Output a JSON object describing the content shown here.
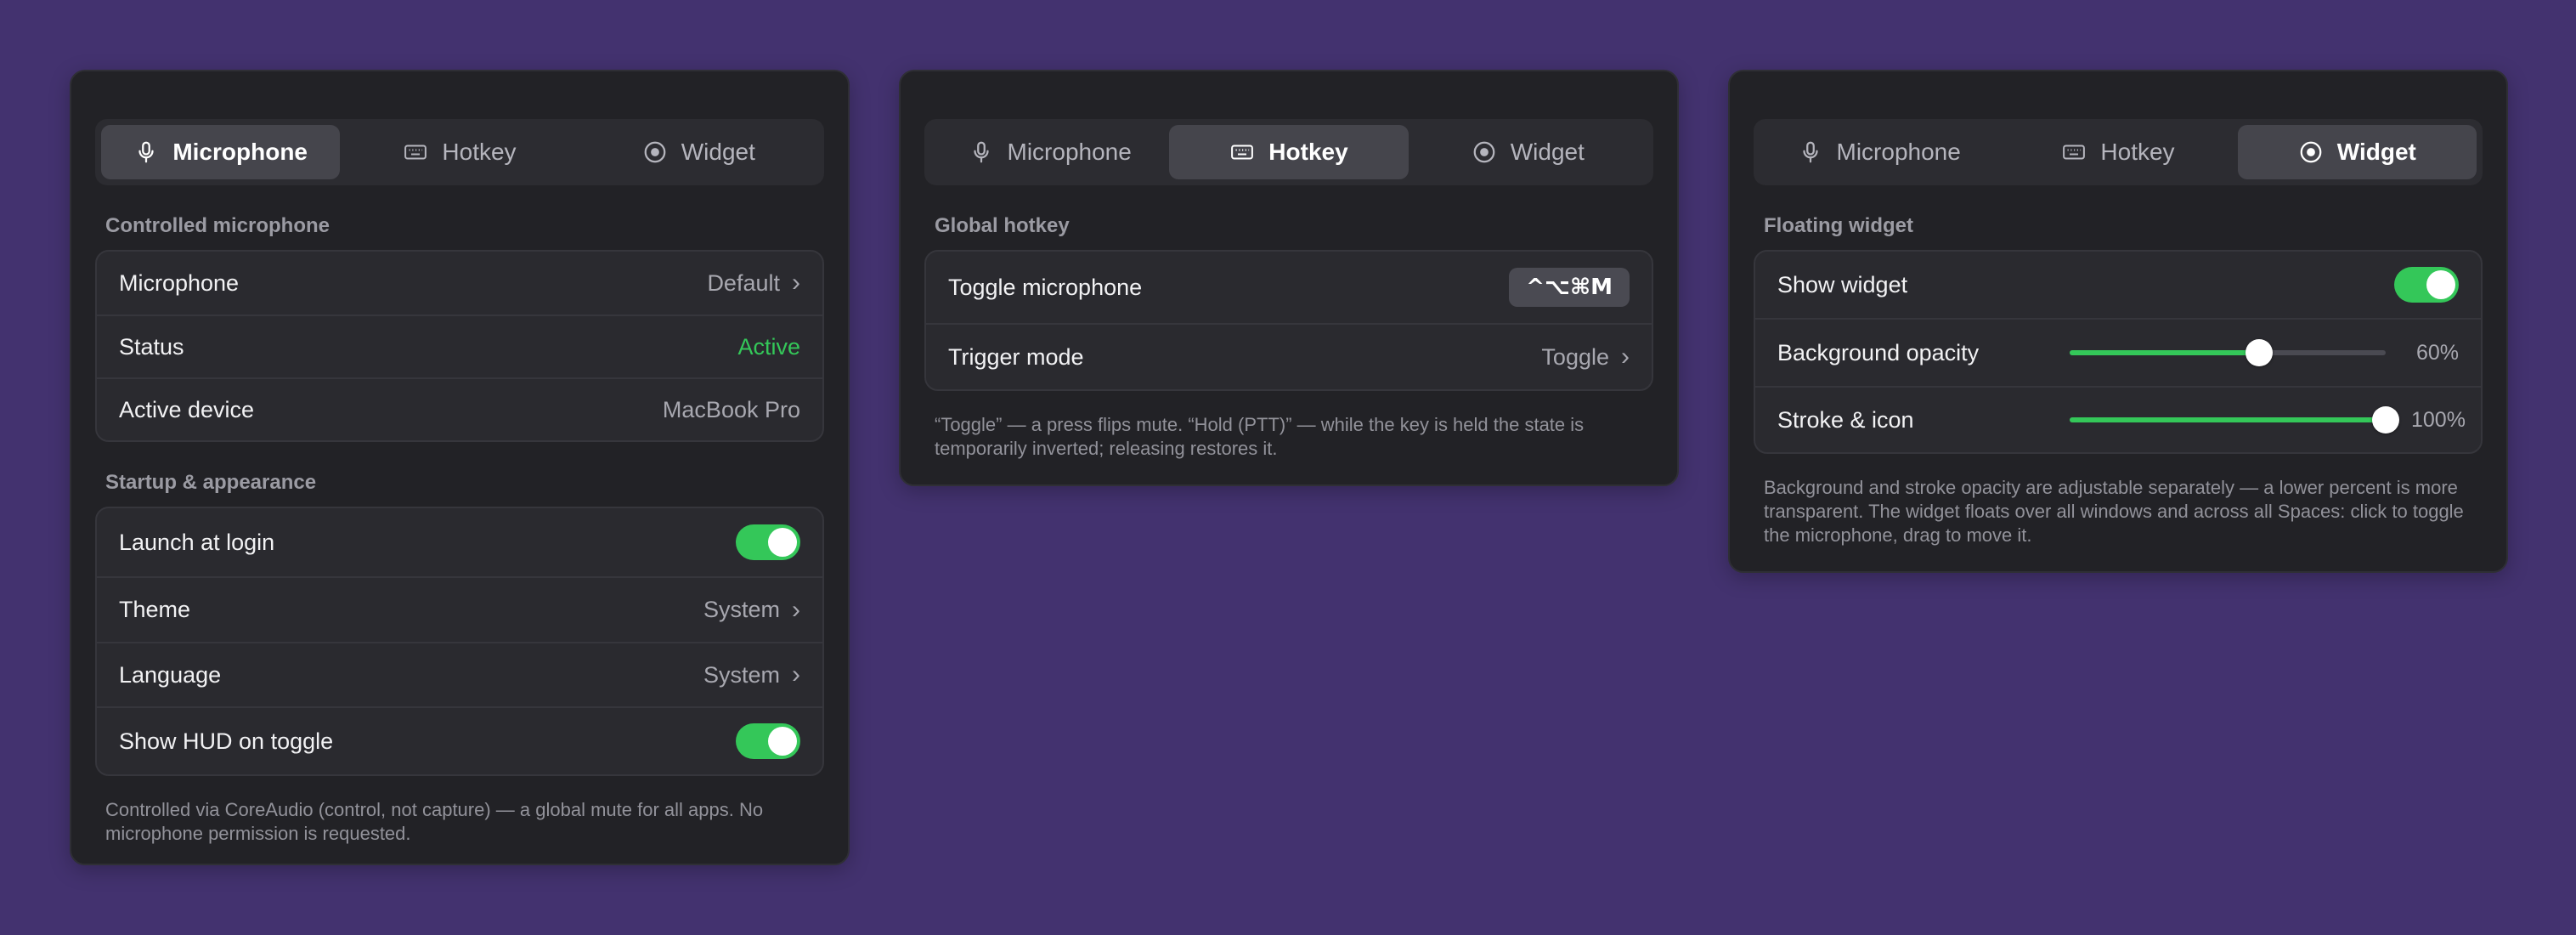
{
  "tabs": {
    "microphone": "Microphone",
    "hotkey": "Hotkey",
    "widget": "Widget"
  },
  "mic_panel": {
    "section1": "Controlled microphone",
    "rows": [
      {
        "label": "Microphone",
        "value": "Default"
      },
      {
        "label": "Status",
        "value": "Active"
      },
      {
        "label": "Active device",
        "value": "MacBook Pro"
      }
    ],
    "section2": "Startup & appearance",
    "launch_label": "Launch at login",
    "launch_on": true,
    "theme_label": "Theme",
    "theme_value": "System",
    "language_label": "Language",
    "language_value": "System",
    "hud_label": "Show HUD on toggle",
    "hud_on": true,
    "footnote": "Controlled via CoreAudio (control, not capture) — a global mute for all apps. No microphone permission is requested."
  },
  "hotkey_panel": {
    "section": "Global hotkey",
    "toggle_label": "Toggle microphone",
    "shortcut": "^⌥⌘M",
    "trigger_label": "Trigger mode",
    "trigger_value": "Toggle",
    "footnote": "“Toggle” — a press flips mute. “Hold (PTT)” — while the key is held the state is temporarily inverted; releasing restores it."
  },
  "widget_panel": {
    "section": "Floating widget",
    "show_label": "Show widget",
    "show_on": true,
    "bg_label": "Background opacity",
    "bg_value": 0.6,
    "bg_text": "60%",
    "stroke_label": "Stroke & icon",
    "stroke_value": 1.0,
    "stroke_text": "100%",
    "footnote": "Background and stroke opacity are adjustable separately — a lower percent is more transparent. The widget floats over all windows and across all Spaces: click to toggle the microphone, drag to move it."
  },
  "colors": {
    "background": "#43326f",
    "accent_green": "#34c759",
    "panel": "#222226"
  }
}
